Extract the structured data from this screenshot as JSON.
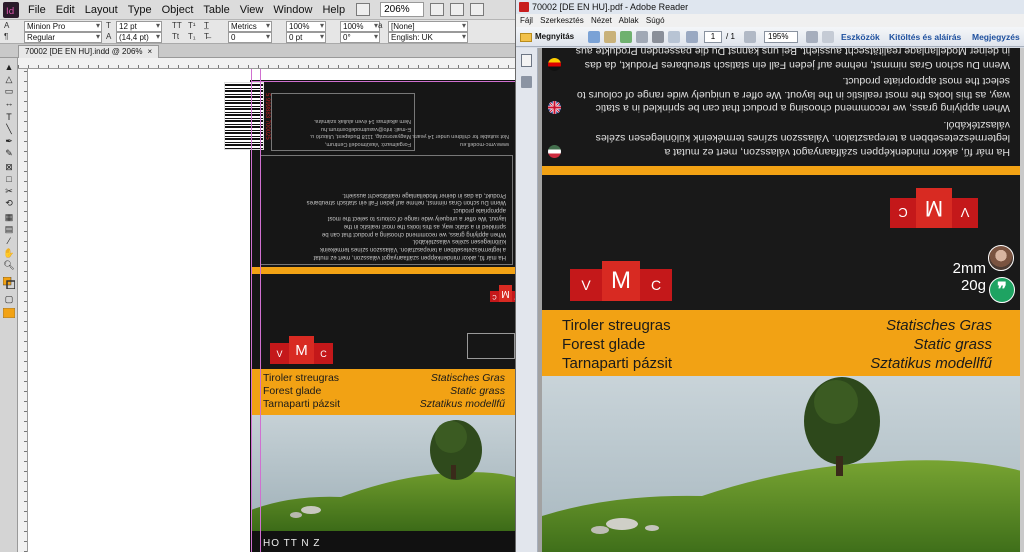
{
  "indesign": {
    "menu": [
      "File",
      "Edit",
      "Layout",
      "Type",
      "Object",
      "Table",
      "View",
      "Window",
      "Help"
    ],
    "zoom": "206%",
    "control": {
      "font_family": "Minion Pro",
      "font_style": "Regular",
      "font_size": "12 pt",
      "leading": "(14,4 pt)",
      "kerning": "Metrics",
      "tracking": "0",
      "horizontal_scale": "100%",
      "vertical_scale": "100%",
      "baseline_shift": "0 pt",
      "skew": "0°",
      "char_style": "[None]",
      "language": "English: UK"
    },
    "document_tab": "70002 [DE EN HU].indd @ 206%",
    "label": {
      "address_lines": [
        "Forgalmazó: Vasútmodell Centrum,",
        "Magyarország, 1118 Budapest, Ulászló u.",
        "E-mail: info@vasutmodellcentrum.hu",
        "Nem alkalmas 14 éven aluliak számára."
      ],
      "web_lines": [
        "www.vmc-modell.eu",
        "Not suitable for children under 14 years."
      ],
      "description_lines": [
        "Ha már fű, akkor mindenképpen szálfaanyagot válasszon, mert ez mutat",
        "a legtermészetesebben a terepasztalon. Válasszon színes termékeink",
        "különlegesen széles választékából.",
        "When applying grass, we recommend choosing a product that can be",
        "sprinkled in a static way, as this looks the most realistic in the",
        "layout. We offer a uniquely wide range of colours to select the most",
        "appropriate product.",
        "Wenn Du schon Gras nimmst, nehme auf jeden Fall ein statisch streubares",
        "Produkt, da das in deiner Modellanlage realitätsecht aussieht."
      ],
      "logo_letters": [
        "V",
        "M",
        "C"
      ],
      "names_left": [
        "Tiroler streugras",
        "Forest glade",
        "Tarnaparti pázsit"
      ],
      "names_right": [
        "Statisches Gras",
        "Static grass",
        "Sztatikus modellfű"
      ],
      "bottom_codes": "HO  TT  N  Z"
    }
  },
  "reader": {
    "title": "70002 [DE EN HU].pdf - Adobe Reader",
    "menu": [
      "Fájl",
      "Szerkesztés",
      "Nézet",
      "Ablak",
      "Súgó"
    ],
    "open_label": "Megnyitás",
    "page_current": "1",
    "page_total": "/ 1",
    "zoom": "195%",
    "links": [
      "Eszközök",
      "Kitöltés és aláírás",
      "Megjegyzés"
    ],
    "paragraphs": [
      {
        "lang": "hu",
        "text": "Ha már fű, akkor mindenképpen szálfaanyagot válasszon, mert ez mutat a legtermészetesebben a terepasztalon. Válasszon színes termékeink különlegesen széles választékából."
      },
      {
        "lang": "en",
        "text": "When applying grass, we recommend choosing a product that can be sprinkled in a static way, as this looks the most realistic in the layout. We offer a uniquely wide range of colours to select the most appropriate product."
      },
      {
        "lang": "de",
        "text": "Wenn Du schon Gras nimmst, nehme auf jeden Fall ein statisch streubares Produkt, da das in deiner Modellanlage realitätsecht aussieht. Bei uns kannst Du die passenden Produkte aus einer einzigartig breiten Farbskala auswählen."
      }
    ],
    "logo_letters": [
      "V",
      "M",
      "C"
    ],
    "size": "2mm",
    "weight": "20g",
    "names_left": [
      "Tiroler streugras",
      "Forest glade",
      "Tarnaparti pázsit"
    ],
    "names_right": [
      "Statisches Gras",
      "Static grass",
      "Sztatikus modellfű"
    ]
  },
  "colors": {
    "vmc_red": "#c4181a",
    "label_orange": "#f2a214",
    "label_black": "#191919",
    "chat_green": "#1ea362"
  }
}
